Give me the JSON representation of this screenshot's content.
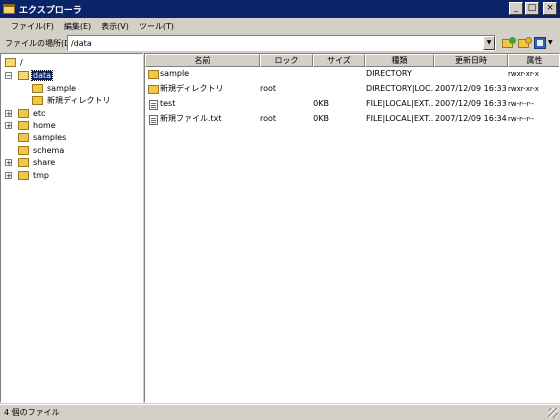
{
  "window": {
    "title": "エクスプローラ",
    "caption_buttons": [
      "_",
      "□",
      "×"
    ]
  },
  "menu": [
    {
      "label": "ファイル(F)"
    },
    {
      "label": "編集(E)"
    },
    {
      "label": "表示(V)"
    },
    {
      "label": "ツール(T)"
    }
  ],
  "address": {
    "label": "ファイルの場所(D)",
    "value": "/data",
    "dropdown_glyph": "▼"
  },
  "tree": {
    "root": {
      "label": "/",
      "icon": "open-folder-icon"
    },
    "nodes": [
      {
        "label": "data",
        "expander": "⊟",
        "selected": true
      },
      {
        "label": "sample"
      },
      {
        "label": "新規ディレクトリ"
      },
      {
        "label": "etc",
        "expander": "⊞"
      },
      {
        "label": "home",
        "expander": "⊞"
      },
      {
        "label": "samples"
      },
      {
        "label": "schema"
      },
      {
        "label": "share",
        "expander": "⊞"
      },
      {
        "label": "tmp",
        "expander": "⊞"
      }
    ]
  },
  "list": {
    "columns": [
      "名前",
      "ロック",
      "サイズ",
      "種類",
      "更新日時",
      "属性"
    ],
    "rows": [
      {
        "name": "sample",
        "lock": "",
        "size": "",
        "type": "DIRECTORY",
        "modified": "",
        "attr": "rwxr-xr-x",
        "icon": "folder-icon"
      },
      {
        "name": "新規ディレクトリ",
        "lock": "root",
        "size": "",
        "type": "DIRECTORY|LOC...",
        "modified": "2007/12/09 16:33",
        "attr": "rwxr-xr-x",
        "icon": "folder-icon"
      },
      {
        "name": "test",
        "lock": "",
        "size": "0KB",
        "type": "FILE|LOCAL|EXT...",
        "modified": "2007/12/09 16:33",
        "attr": "rw-r--r--",
        "icon": "file-icon"
      },
      {
        "name": "新規ファイル.txt",
        "lock": "root",
        "size": "0KB",
        "type": "FILE|LOCAL|EXT...",
        "modified": "2007/12/09 16:34",
        "attr": "rw-r--r--",
        "icon": "file-icon"
      }
    ]
  },
  "status": {
    "text": "4 個のファイル"
  },
  "colors": {
    "titlebar": "#0a246a",
    "face": "#d4d0c8",
    "folder": "#f2c649",
    "selection": "#0a246a"
  }
}
